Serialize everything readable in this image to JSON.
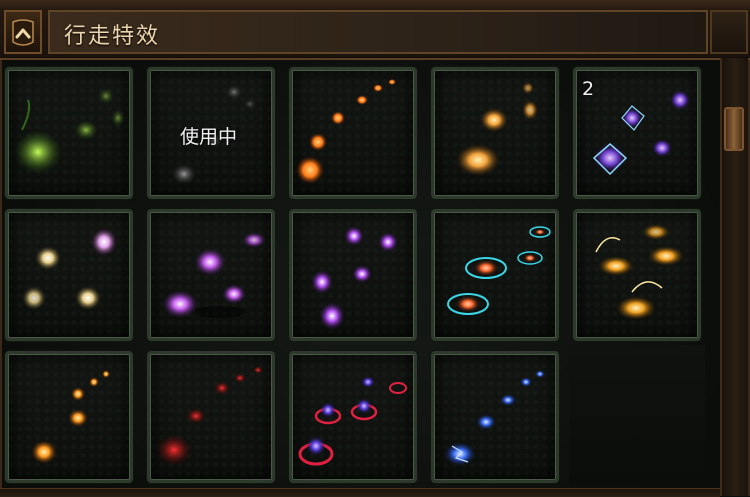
{
  "header": {
    "title": "行走特效",
    "back_icon": "chevron-up-icon"
  },
  "effects": [
    {
      "name": "green-wisp-trail",
      "text": ""
    },
    {
      "name": "grey-smoke-trail",
      "text": "使用中"
    },
    {
      "name": "orange-flame-trail",
      "text": ""
    },
    {
      "name": "golden-burst-trail",
      "text": ""
    },
    {
      "name": "purple-crystal-trail",
      "text": "2"
    },
    {
      "name": "light-orb-trail",
      "text": ""
    },
    {
      "name": "purple-blossom-trail",
      "text": ""
    },
    {
      "name": "violet-petal-trail",
      "text": ""
    },
    {
      "name": "cyan-ring-orb-trail",
      "text": ""
    },
    {
      "name": "golden-spark-trail",
      "text": ""
    },
    {
      "name": "ember-trail",
      "text": ""
    },
    {
      "name": "red-dust-trail",
      "text": ""
    },
    {
      "name": "crimson-vortex-trail",
      "text": ""
    },
    {
      "name": "blue-lightning-trail",
      "text": ""
    }
  ],
  "colors": {
    "frame": "#3a2818",
    "cell_border": "#2d3a2b",
    "title_text": "#ecd6b0",
    "scroll_thumb": "#8d6238"
  }
}
